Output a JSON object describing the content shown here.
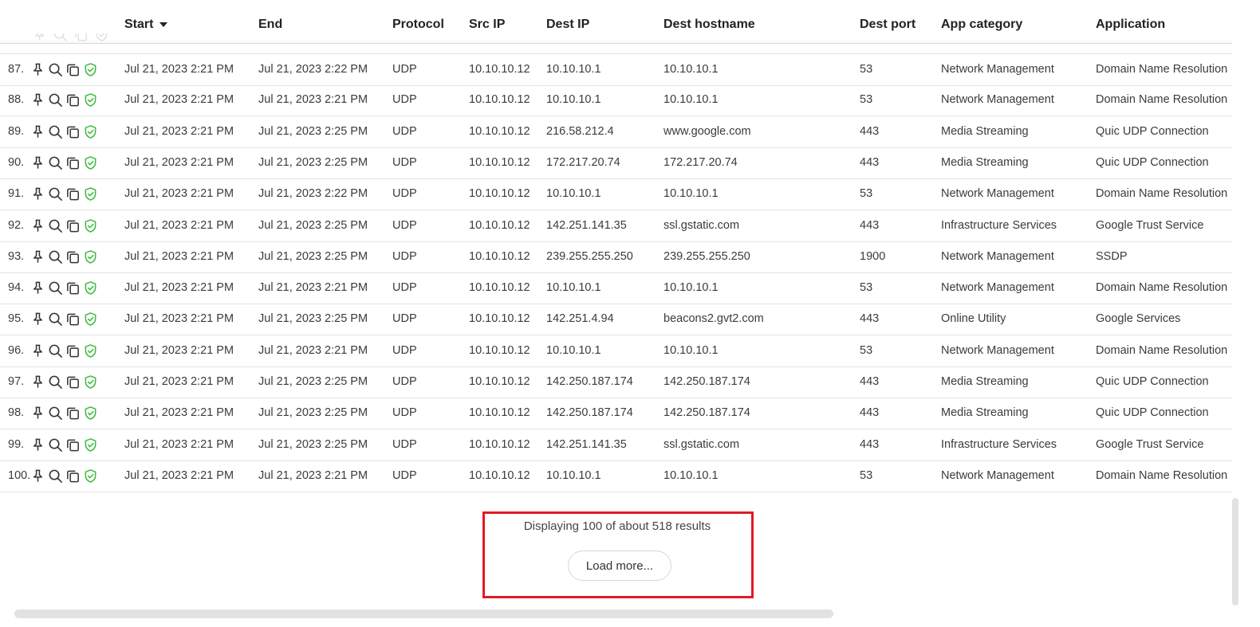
{
  "columns": {
    "start": "Start",
    "end": "End",
    "protocol": "Protocol",
    "src_ip": "Src IP",
    "dest_ip": "Dest IP",
    "dest_hostname": "Dest hostname",
    "dest_port": "Dest port",
    "app_category": "App category",
    "application": "Application"
  },
  "sort": {
    "column": "Start",
    "direction": "descending"
  },
  "icons": [
    "pin-icon",
    "search-icon",
    "copy-icon",
    "shield-check-icon"
  ],
  "colors": {
    "shield": "#3dbb3d",
    "highlight": "#e01b24"
  },
  "rows": [
    {
      "index": "87.",
      "start": "Jul 21, 2023 2:21 PM",
      "end": "Jul 21, 2023 2:22 PM",
      "protocol": "UDP",
      "src_ip": "10.10.10.12",
      "dest_ip": "10.10.10.1",
      "dest_hostname": "10.10.10.1",
      "dest_port": "53",
      "app_category": "Network Management",
      "application": "Domain Name Resolution"
    },
    {
      "index": "88.",
      "start": "Jul 21, 2023 2:21 PM",
      "end": "Jul 21, 2023 2:21 PM",
      "protocol": "UDP",
      "src_ip": "10.10.10.12",
      "dest_ip": "10.10.10.1",
      "dest_hostname": "10.10.10.1",
      "dest_port": "53",
      "app_category": "Network Management",
      "application": "Domain Name Resolution"
    },
    {
      "index": "89.",
      "start": "Jul 21, 2023 2:21 PM",
      "end": "Jul 21, 2023 2:25 PM",
      "protocol": "UDP",
      "src_ip": "10.10.10.12",
      "dest_ip": "216.58.212.4",
      "dest_hostname": "www.google.com",
      "dest_port": "443",
      "app_category": "Media Streaming",
      "application": "Quic UDP Connection"
    },
    {
      "index": "90.",
      "start": "Jul 21, 2023 2:21 PM",
      "end": "Jul 21, 2023 2:25 PM",
      "protocol": "UDP",
      "src_ip": "10.10.10.12",
      "dest_ip": "172.217.20.74",
      "dest_hostname": "172.217.20.74",
      "dest_port": "443",
      "app_category": "Media Streaming",
      "application": "Quic UDP Connection"
    },
    {
      "index": "91.",
      "start": "Jul 21, 2023 2:21 PM",
      "end": "Jul 21, 2023 2:22 PM",
      "protocol": "UDP",
      "src_ip": "10.10.10.12",
      "dest_ip": "10.10.10.1",
      "dest_hostname": "10.10.10.1",
      "dest_port": "53",
      "app_category": "Network Management",
      "application": "Domain Name Resolution"
    },
    {
      "index": "92.",
      "start": "Jul 21, 2023 2:21 PM",
      "end": "Jul 21, 2023 2:25 PM",
      "protocol": "UDP",
      "src_ip": "10.10.10.12",
      "dest_ip": "142.251.141.35",
      "dest_hostname": "ssl.gstatic.com",
      "dest_port": "443",
      "app_category": "Infrastructure Services",
      "application": "Google Trust Service"
    },
    {
      "index": "93.",
      "start": "Jul 21, 2023 2:21 PM",
      "end": "Jul 21, 2023 2:25 PM",
      "protocol": "UDP",
      "src_ip": "10.10.10.12",
      "dest_ip": "239.255.255.250",
      "dest_hostname": "239.255.255.250",
      "dest_port": "1900",
      "app_category": "Network Management",
      "application": "SSDP"
    },
    {
      "index": "94.",
      "start": "Jul 21, 2023 2:21 PM",
      "end": "Jul 21, 2023 2:21 PM",
      "protocol": "UDP",
      "src_ip": "10.10.10.12",
      "dest_ip": "10.10.10.1",
      "dest_hostname": "10.10.10.1",
      "dest_port": "53",
      "app_category": "Network Management",
      "application": "Domain Name Resolution"
    },
    {
      "index": "95.",
      "start": "Jul 21, 2023 2:21 PM",
      "end": "Jul 21, 2023 2:25 PM",
      "protocol": "UDP",
      "src_ip": "10.10.10.12",
      "dest_ip": "142.251.4.94",
      "dest_hostname": "beacons2.gvt2.com",
      "dest_port": "443",
      "app_category": "Online Utility",
      "application": "Google Services"
    },
    {
      "index": "96.",
      "start": "Jul 21, 2023 2:21 PM",
      "end": "Jul 21, 2023 2:21 PM",
      "protocol": "UDP",
      "src_ip": "10.10.10.12",
      "dest_ip": "10.10.10.1",
      "dest_hostname": "10.10.10.1",
      "dest_port": "53",
      "app_category": "Network Management",
      "application": "Domain Name Resolution"
    },
    {
      "index": "97.",
      "start": "Jul 21, 2023 2:21 PM",
      "end": "Jul 21, 2023 2:25 PM",
      "protocol": "UDP",
      "src_ip": "10.10.10.12",
      "dest_ip": "142.250.187.174",
      "dest_hostname": "142.250.187.174",
      "dest_port": "443",
      "app_category": "Media Streaming",
      "application": "Quic UDP Connection"
    },
    {
      "index": "98.",
      "start": "Jul 21, 2023 2:21 PM",
      "end": "Jul 21, 2023 2:25 PM",
      "protocol": "UDP",
      "src_ip": "10.10.10.12",
      "dest_ip": "142.250.187.174",
      "dest_hostname": "142.250.187.174",
      "dest_port": "443",
      "app_category": "Media Streaming",
      "application": "Quic UDP Connection"
    },
    {
      "index": "99.",
      "start": "Jul 21, 2023 2:21 PM",
      "end": "Jul 21, 2023 2:25 PM",
      "protocol": "UDP",
      "src_ip": "10.10.10.12",
      "dest_ip": "142.251.141.35",
      "dest_hostname": "ssl.gstatic.com",
      "dest_port": "443",
      "app_category": "Infrastructure Services",
      "application": "Google Trust Service"
    },
    {
      "index": "100.",
      "start": "Jul 21, 2023 2:21 PM",
      "end": "Jul 21, 2023 2:21 PM",
      "protocol": "UDP",
      "src_ip": "10.10.10.12",
      "dest_ip": "10.10.10.1",
      "dest_hostname": "10.10.10.1",
      "dest_port": "53",
      "app_category": "Network Management",
      "application": "Domain Name Resolution"
    }
  ],
  "footer": {
    "status": "Displaying 100 of about 518 results",
    "load_more_label": "Load more..."
  }
}
